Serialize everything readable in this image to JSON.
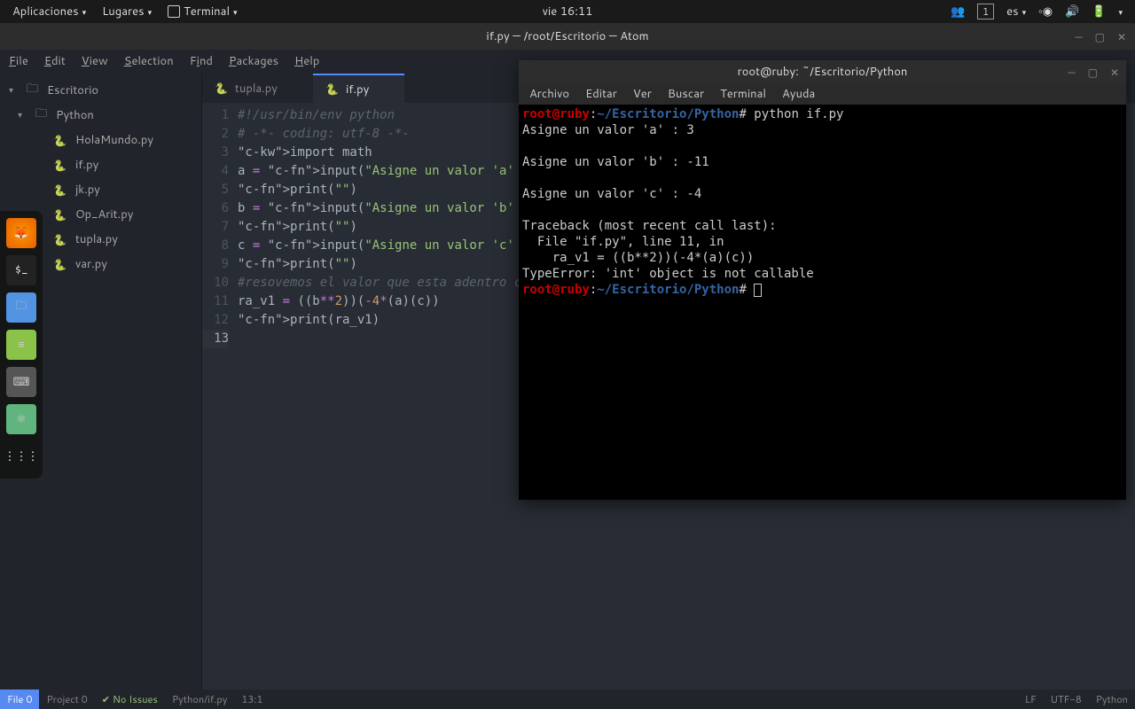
{
  "topbar": {
    "apps": "Aplicaciones",
    "places": "Lugares",
    "terminal": "Terminal",
    "clock": "vie 16:11",
    "workspace": "1",
    "lang": "es"
  },
  "atom": {
    "title": "if.py — /root/Escritorio — Atom",
    "menu": [
      "File",
      "Edit",
      "View",
      "Selection",
      "Find",
      "Packages",
      "Help"
    ],
    "tree_root": "Escritorio",
    "tree_folder": "Python",
    "files": [
      "HolaMundo.py",
      "if.py",
      "jk.py",
      "Op_Arit.py",
      "tupla.py",
      "var.py"
    ],
    "tabs": [
      {
        "label": "tupla.py",
        "active": false
      },
      {
        "label": "if.py",
        "active": true
      }
    ],
    "code_lines": [
      "#!/usr/bin/env python",
      "# -*- coding: utf-8 -*-",
      "import math",
      "a = input(\"Asigne un valor 'a' : \")",
      "print(\"\")",
      "b = input(\"Asigne un valor 'b' : \")",
      "print(\"\")",
      "c = input(\"Asigne un valor 'c' : \")",
      "print(\"\")",
      "#resovemos el valor que esta adentro c",
      "ra_v1 = ((b**2))(-4*(a)(c))",
      "print(ra_v1)",
      ""
    ]
  },
  "terminal": {
    "title": "root@ruby: ~/Escritorio/Python",
    "menu": [
      "Archivo",
      "Editar",
      "Ver",
      "Buscar",
      "Terminal",
      "Ayuda"
    ],
    "prompt_user": "root@ruby",
    "prompt_path": "~/Escritorio/Python",
    "cmd1": "python if.py",
    "out": [
      "Asigne un valor 'a' : 3",
      "",
      "Asigne un valor 'b' : -11",
      "",
      "Asigne un valor 'c' : -4",
      "",
      "Traceback (most recent call last):",
      "  File \"if.py\", line 11, in <module>",
      "    ra_v1 = ((b**2))(-4*(a)(c))",
      "TypeError: 'int' object is not callable"
    ]
  },
  "status": {
    "file0": "File 0",
    "project": "Project 0",
    "issues": "No Issues",
    "path": "Python/if.py",
    "cursor": "13:1",
    "eol": "LF",
    "enc": "UTF-8",
    "lang": "Python"
  }
}
